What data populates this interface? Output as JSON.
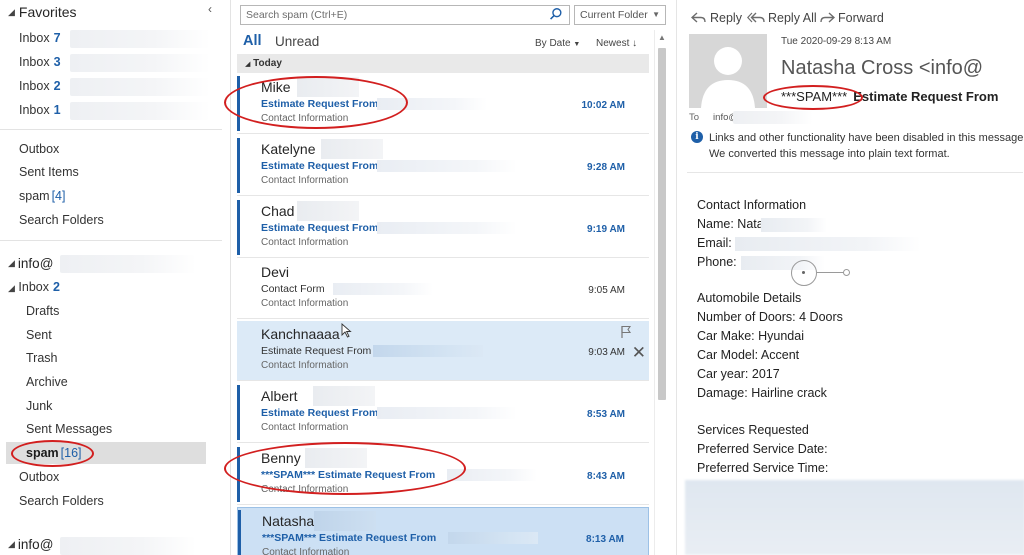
{
  "folders": {
    "favorites_label": "Favorites",
    "fav_items": [
      {
        "label": "Inbox",
        "count": "7"
      },
      {
        "label": "Inbox",
        "count": "3"
      },
      {
        "label": "Inbox",
        "count": "2"
      },
      {
        "label": "Inbox",
        "count": "1"
      }
    ],
    "misc_items": [
      "Outbox",
      "Sent Items",
      "spam",
      "Search Folders"
    ],
    "spam_count": "[4]",
    "account_label": "info@",
    "account_inbox": {
      "label": "Inbox",
      "count": "2"
    },
    "account_items": [
      "Drafts",
      "Sent",
      "Trash",
      "Archive",
      "Junk",
      "Sent Messages"
    ],
    "spam_selected": {
      "label": "spam",
      "count": "[16]"
    },
    "account_tail": [
      "Outbox",
      "Search Folders"
    ],
    "account2_label": "info@"
  },
  "list": {
    "search_placeholder": "Search spam (Ctrl+E)",
    "scope": "Current Folder",
    "filter_all": "All",
    "filter_unread": "Unread",
    "sort_by": "By Date",
    "sort_order": "Newest",
    "group": "Today",
    "messages": [
      {
        "sender": "Mike",
        "subject": "Estimate Request From",
        "preview": "Contact Information",
        "time": "10:02 AM",
        "unread": true
      },
      {
        "sender": "Katelyne",
        "subject": "Estimate Request From",
        "preview": "Contact Information",
        "time": "9:28 AM",
        "unread": true
      },
      {
        "sender": "Chad",
        "subject": "Estimate Request From",
        "preview": "Contact Information",
        "time": "9:19 AM",
        "unread": true
      },
      {
        "sender": "Devi",
        "subject": "Contact Form",
        "preview": "Contact Information",
        "time": "9:05 AM",
        "unread": false
      },
      {
        "sender": "Kanchnaaaa",
        "subject": "Estimate Request From",
        "preview": "Contact Information",
        "time": "9:03 AM",
        "unread": false
      },
      {
        "sender": "Albert",
        "subject": "Estimate Request From",
        "preview": "Contact Information",
        "time": "8:53 AM",
        "unread": true
      },
      {
        "sender": "Benny",
        "subject": "***SPAM***  Estimate Request From",
        "preview": "Contact Information",
        "time": "8:43 AM",
        "unread": true
      },
      {
        "sender": "Natasha",
        "subject": "***SPAM***  Estimate Request From",
        "preview": "Contact Information",
        "time": "8:13 AM",
        "unread": true
      }
    ]
  },
  "reading": {
    "reply": "Reply",
    "reply_all": "Reply All",
    "forward": "Forward",
    "date": "Tue 2020-09-29 8:13 AM",
    "from": "Natasha Cross <info@",
    "subject_tag": "***SPAM***",
    "subject_rest": "Estimate Request From",
    "to_label": "To",
    "to_value": "info@",
    "info_line1": "Links and other functionality have been disabled in this message",
    "info_line2": "We converted this message into plain text format.",
    "body": [
      "Contact Information",
      "Name: Natasha",
      "Email:",
      "Phone:",
      "",
      "Automobile Details",
      "Number of Doors: 4 Doors",
      "Car Make: Hyundai",
      "Car Model: Accent",
      "Car year: 2017",
      "Damage: Hairline crack",
      "",
      "Services Requested",
      "Preferred Service Date:",
      "Preferred Service Time:"
    ]
  },
  "colors": {
    "accent": "#1e5fa8",
    "highlight": "#d21f1f",
    "selected": "#cce0f4"
  }
}
